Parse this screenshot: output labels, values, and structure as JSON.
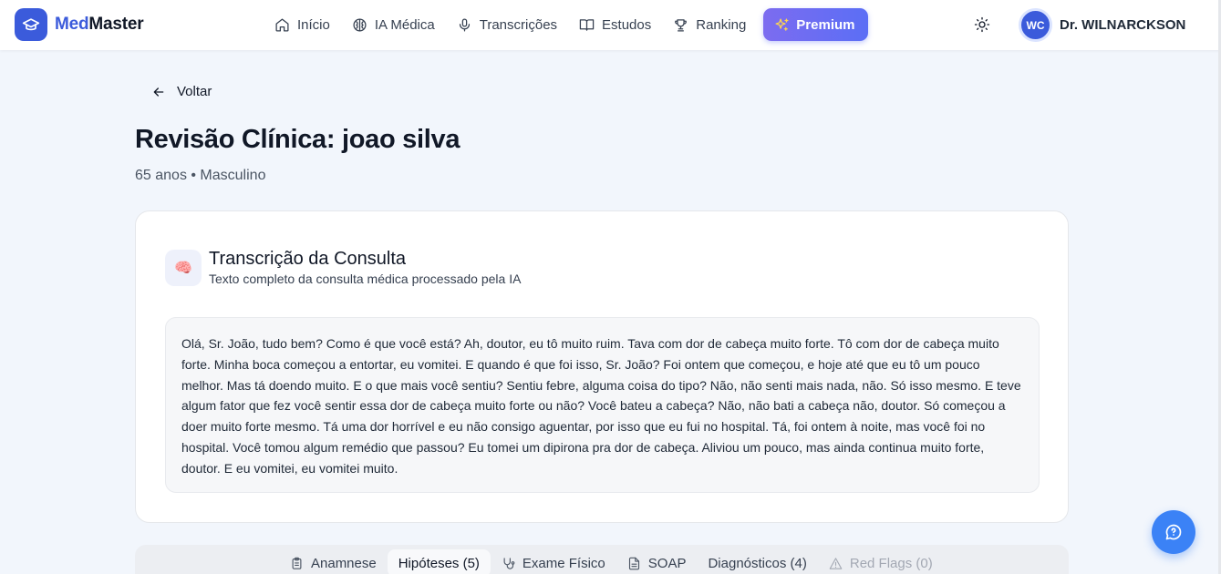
{
  "app": {
    "brand_part1": "Med",
    "brand_part2": "Master",
    "accent_color": "#3b5bdb"
  },
  "nav": {
    "items": [
      {
        "label": "Início",
        "icon": "home-icon"
      },
      {
        "label": "IA Médica",
        "icon": "brain-icon"
      },
      {
        "label": "Transcrições",
        "icon": "microphone-icon"
      },
      {
        "label": "Estudos",
        "icon": "book-icon"
      },
      {
        "label": "Ranking",
        "icon": "trophy-icon"
      }
    ],
    "premium_label": "Premium"
  },
  "user": {
    "initials": "WC",
    "name": "Dr. WILNARCKSON"
  },
  "back_label": "Voltar",
  "page": {
    "title": "Revisão Clínica: joao silva",
    "subtitle": "65 anos • Masculino"
  },
  "transcription_card": {
    "icon": "🧠",
    "title": "Transcrição da Consulta",
    "description": "Texto completo da consulta médica processado pela IA",
    "text": "Olá, Sr. João, tudo bem? Como é que você está? Ah, doutor, eu tô muito ruim. Tava com dor de cabeça muito forte. Tô com dor de cabeça muito forte. Minha boca começou a entortar, eu vomitei. E quando é que foi isso, Sr. João? Foi ontem que começou, e hoje até que eu tô um pouco melhor. Mas tá doendo muito. E o que mais você sentiu? Sentiu febre, alguma coisa do tipo? Não, não senti mais nada, não. Só isso mesmo. E teve algum fator que fez você sentir essa dor de cabeça muito forte ou não? Você bateu a cabeça? Não, não bati a cabeça não, doutor. Só começou a doer muito forte mesmo. Tá uma dor horrível e eu não consigo aguentar, por isso que eu fui no hospital. Tá, foi ontem à noite, mas você foi no hospital. Você tomou algum remédio que passou? Eu tomei um dipirona pra dor de cabeça. Aliviou um pouco, mas ainda continua muito forte, doutor. E eu vomitei, eu vomitei muito."
  },
  "tabs": [
    {
      "label": "Anamnese",
      "icon": "clipboard-icon"
    },
    {
      "label": "Hipóteses (5)",
      "icon": ""
    },
    {
      "label": "Exame Físico",
      "icon": "stethoscope-icon"
    },
    {
      "label": "SOAP",
      "icon": "document-icon"
    },
    {
      "label": "Diagnósticos (4)",
      "icon": ""
    },
    {
      "label": "Red Flags (0)",
      "icon": "warning-icon"
    }
  ]
}
